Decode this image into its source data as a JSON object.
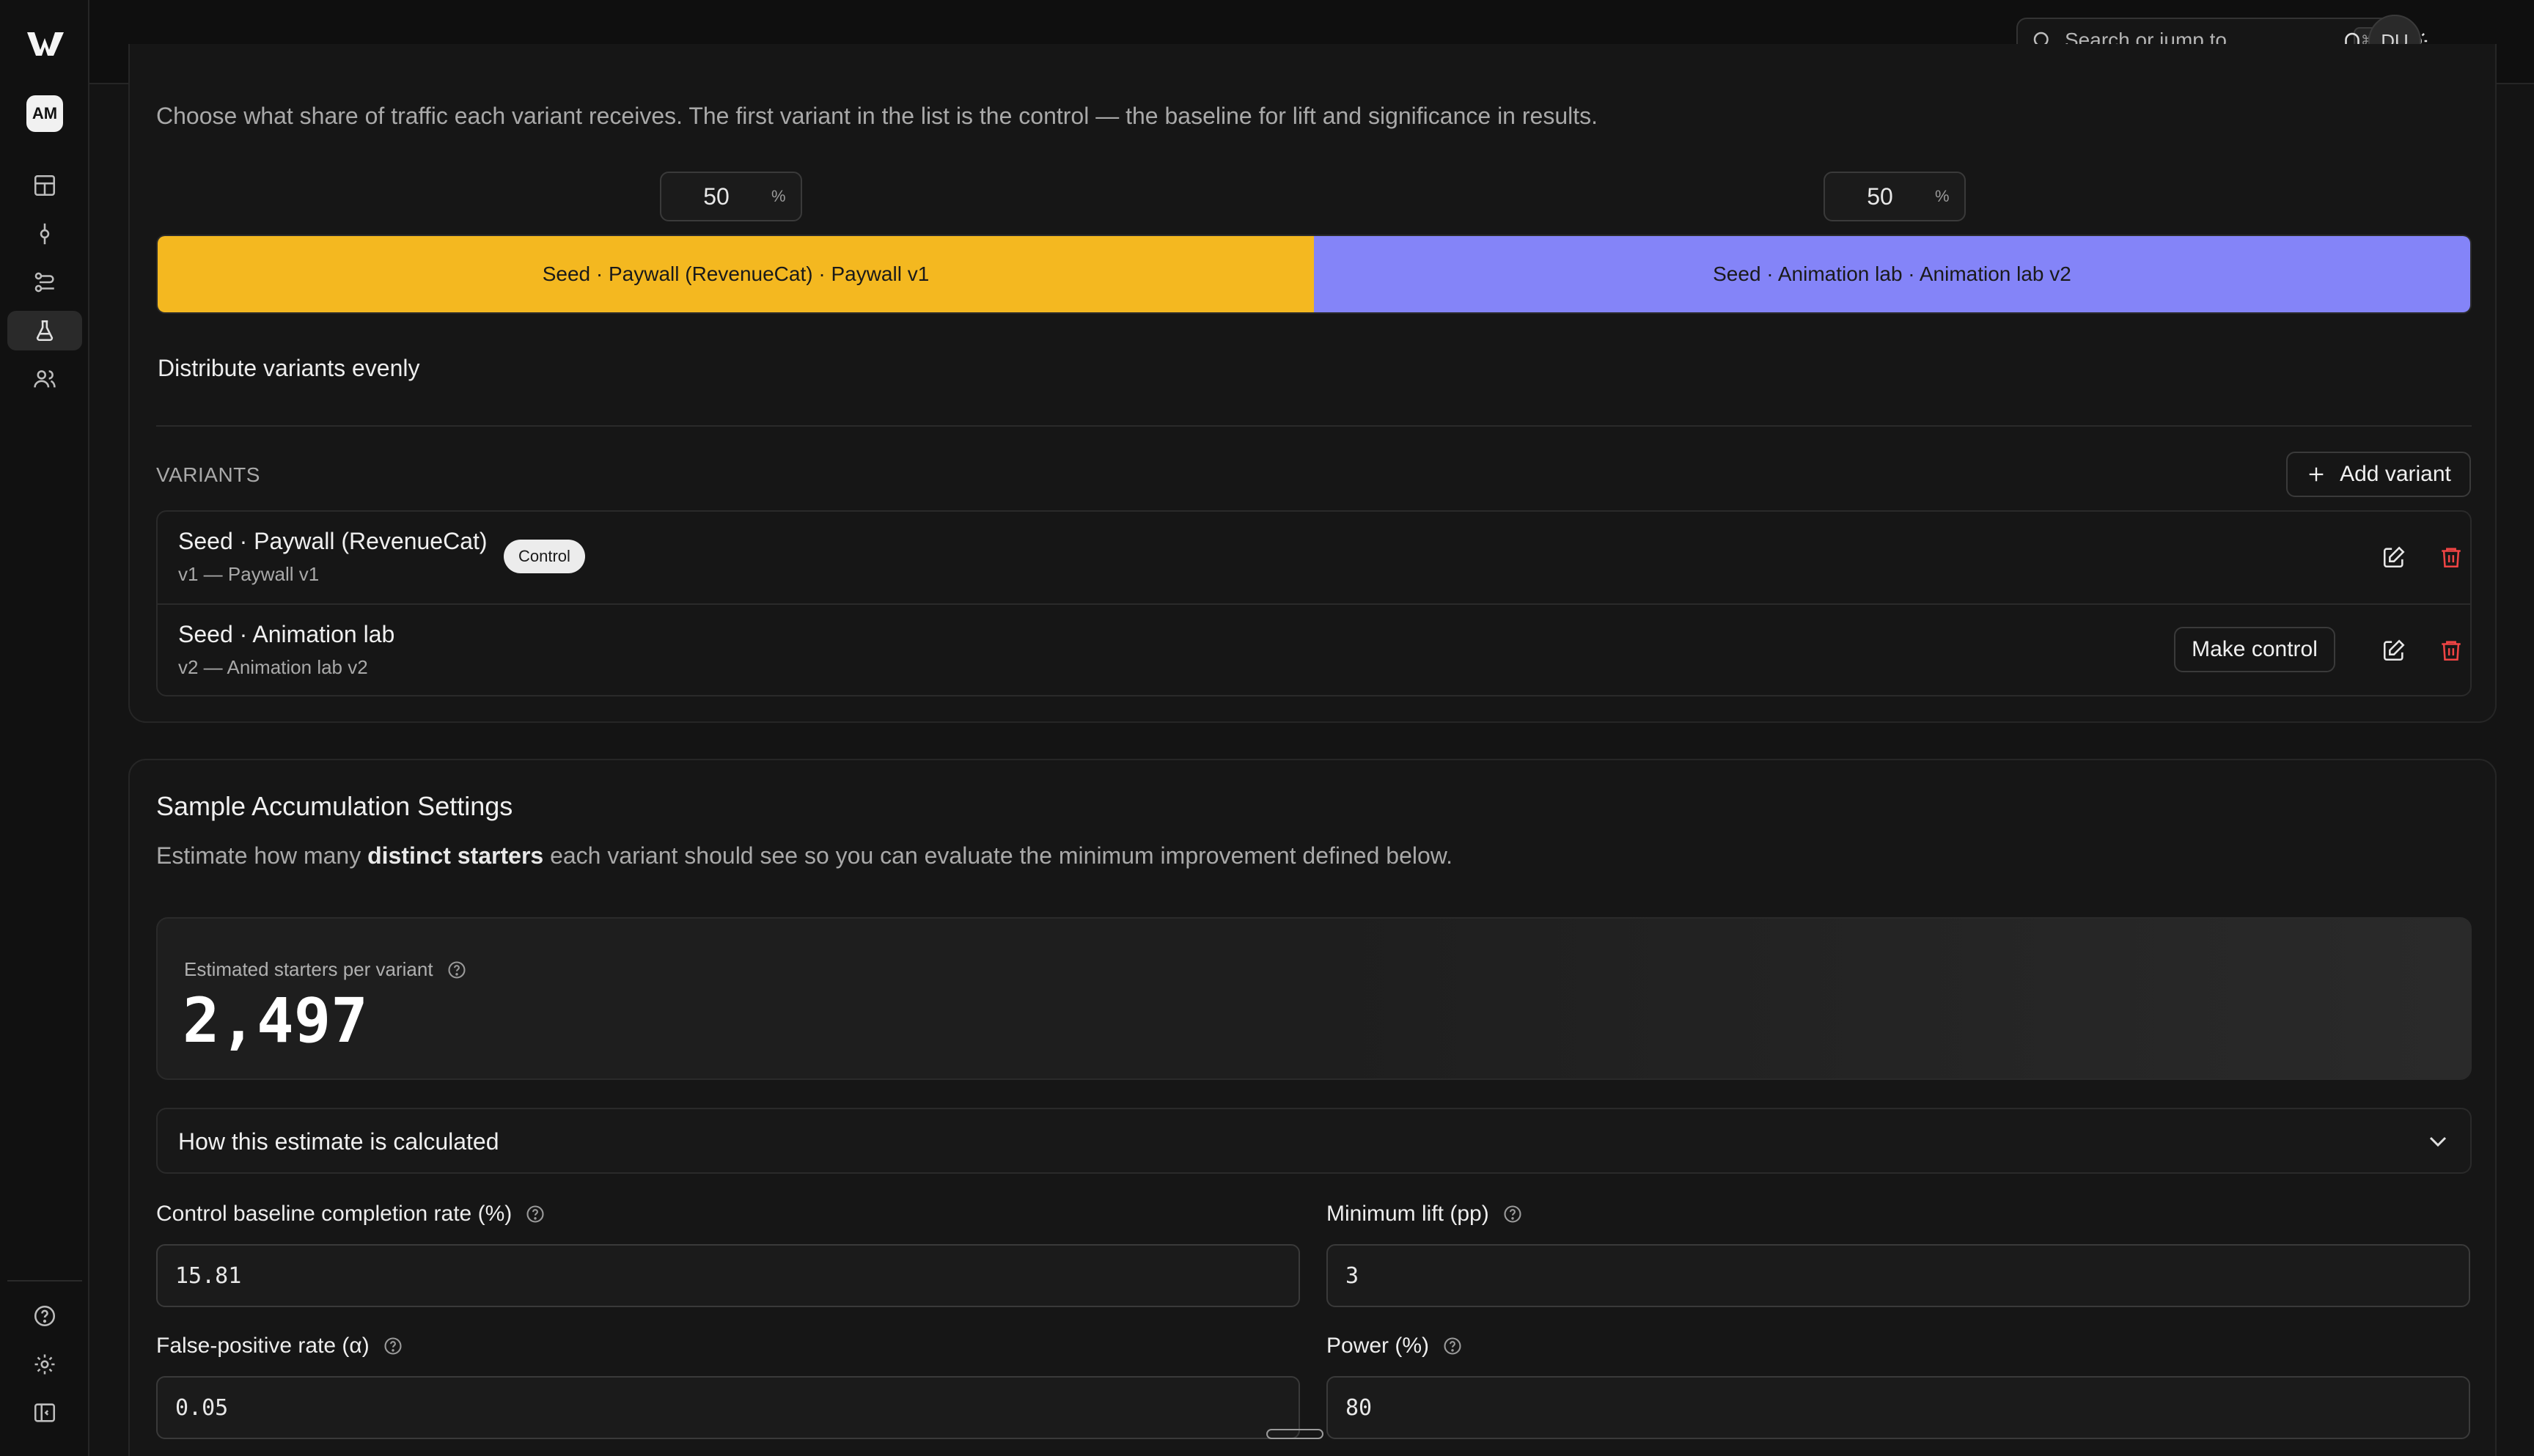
{
  "topbar": {
    "search_placeholder": "Search or jump to...",
    "search_shortcut": "⌘K",
    "user_initials": "DU"
  },
  "sidebar": {
    "org_initials": "AM",
    "items": [
      {
        "name": "dashboard",
        "icon": "layout-icon"
      },
      {
        "name": "commits",
        "icon": "commit-icon"
      },
      {
        "name": "flows",
        "icon": "flow-icon"
      },
      {
        "name": "experiments",
        "icon": "flask-icon",
        "active": true
      },
      {
        "name": "users",
        "icon": "users-icon"
      }
    ],
    "bottom_items": [
      {
        "name": "help",
        "icon": "help-circle-icon"
      },
      {
        "name": "settings",
        "icon": "gear-icon"
      },
      {
        "name": "collapse",
        "icon": "sidebar-toggle-icon"
      }
    ]
  },
  "traffic": {
    "description": "Choose what share of traffic each variant receives. The first variant in the list is the control — the baseline for lift and significance in results.",
    "split": [
      {
        "percent": "50",
        "label": "Seed · Paywall (RevenueCat) · Paywall v1",
        "color": "#f4b820"
      },
      {
        "percent": "50",
        "label": "Seed · Animation lab · Animation lab v2",
        "color": "#8484f8"
      }
    ],
    "percent_sign": "%",
    "distribute_label": "Distribute variants evenly"
  },
  "variants": {
    "section_label": "VARIANTS",
    "add_label": "Add variant",
    "items": [
      {
        "title": "Seed · Paywall (RevenueCat)",
        "subtitle": "v1 — Paywall v1",
        "badge": "Control"
      },
      {
        "title": "Seed · Animation lab",
        "subtitle": "v2 — Animation lab v2",
        "make_control_label": "Make control"
      }
    ]
  },
  "sample": {
    "title": "Sample Accumulation Settings",
    "desc_prefix": "Estimate how many ",
    "desc_bold": "distinct starters",
    "desc_suffix": " each variant should see so you can evaluate the minimum improvement defined below.",
    "estimate_label": "Estimated starters per variant",
    "estimate_value": "2,497",
    "accordion_title": "How this estimate is calculated",
    "fields": [
      {
        "label": "Control baseline completion rate (%)",
        "value": "15.81"
      },
      {
        "label": "Minimum lift (pp)",
        "value": "3"
      },
      {
        "label": "False-positive rate (α)",
        "value": "0.05"
      },
      {
        "label": "Power (%)",
        "value": "80"
      }
    ]
  }
}
